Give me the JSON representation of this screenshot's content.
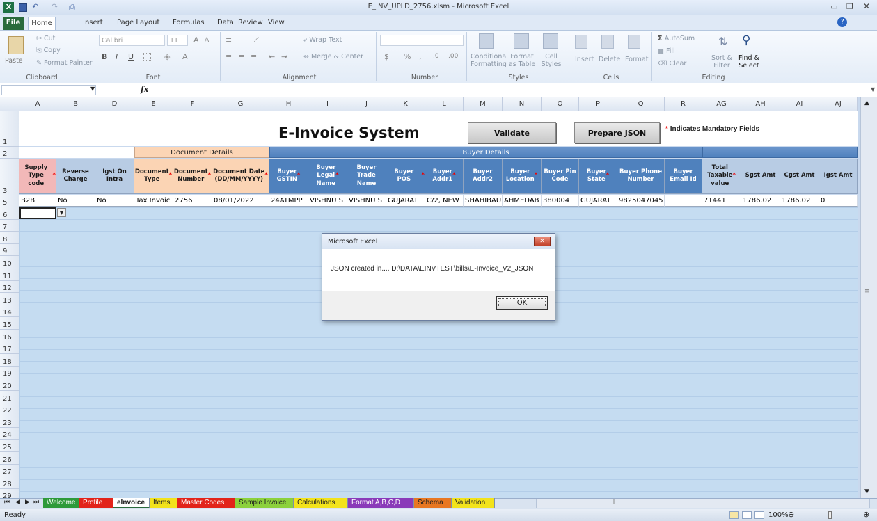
{
  "window": {
    "title": "E_INV_UPLD_2756.xlsm - Microsoft Excel"
  },
  "ribbon": {
    "tabs": [
      "File",
      "Home",
      "Insert",
      "Page Layout",
      "Formulas",
      "Data",
      "Review",
      "View"
    ],
    "clipboard": {
      "paste": "Paste",
      "cut": "Cut",
      "copy": "Copy",
      "format_painter": "Format Painter",
      "label": "Clipboard"
    },
    "font": {
      "name": "Calibri",
      "size": "11",
      "label": "Font"
    },
    "alignment": {
      "wrap_text": "Wrap Text",
      "merge_center": "Merge & Center",
      "label": "Alignment"
    },
    "number": {
      "label": "Number"
    },
    "styles": {
      "conditional": "Conditional Formatting",
      "format_table": "Format as Table",
      "cell_styles": "Cell Styles",
      "label": "Styles"
    },
    "cells": {
      "insert": "Insert",
      "delete": "Delete",
      "format": "Format",
      "label": "Cells"
    },
    "editing": {
      "autosum": "AutoSum",
      "fill": "Fill",
      "clear": "Clear",
      "sort_filter": "Sort & Filter",
      "find_select": "Find & Select",
      "label": "Editing"
    }
  },
  "columns": [
    "A",
    "B",
    "D",
    "E",
    "F",
    "G",
    "H",
    "I",
    "J",
    "K",
    "L",
    "M",
    "N",
    "O",
    "P",
    "Q",
    "R",
    "AG",
    "AH",
    "AI",
    "AJ"
  ],
  "rows": [
    "1",
    "2",
    "3",
    "5",
    "6",
    "7",
    "8",
    "9",
    "10",
    "11",
    "12",
    "13",
    "14",
    "15",
    "16",
    "17",
    "18",
    "19",
    "20",
    "21",
    "22",
    "23",
    "24",
    "25",
    "26",
    "27",
    "28",
    "29"
  ],
  "sheet": {
    "title": "E-Invoice System",
    "validate_button": "Validate",
    "prepare_json_button": "Prepare JSON",
    "mandatory_note": "Indicates Mandatory Fields",
    "mandatory_star": "*",
    "group_document": "Document Details",
    "group_buyer": "Buyer Details",
    "headers": [
      {
        "label": "Supply\nType code",
        "req": true
      },
      {
        "label": "Reverse\nCharge",
        "req": false
      },
      {
        "label": "Igst On\nIntra",
        "req": false
      },
      {
        "label": "Document\nType",
        "req": true
      },
      {
        "label": "Document\nNumber",
        "req": true
      },
      {
        "label": "Document Date\n(DD/MM/YYYY)",
        "req": true
      },
      {
        "label": "Buyer\nGSTIN",
        "req": true
      },
      {
        "label": "Buyer\nLegal\nName",
        "req": true
      },
      {
        "label": "Buyer\nTrade\nName",
        "req": false
      },
      {
        "label": "Buyer POS",
        "req": true
      },
      {
        "label": "Buyer\nAddr1",
        "req": true
      },
      {
        "label": "Buyer\nAddr2",
        "req": false
      },
      {
        "label": "Buyer\nLocation",
        "req": true
      },
      {
        "label": "Buyer Pin\nCode",
        "req": false
      },
      {
        "label": "Buyer\nState",
        "req": true
      },
      {
        "label": "Buyer Phone\nNumber",
        "req": false
      },
      {
        "label": "Buyer\nEmail Id",
        "req": false
      },
      {
        "label": "Total\nTaxable\nvalue",
        "req": true
      },
      {
        "label": "Sgst Amt",
        "req": false
      },
      {
        "label": "Cgst Amt",
        "req": false
      },
      {
        "label": "Igst Amt",
        "req": false
      }
    ],
    "data_row": [
      "B2B",
      "No",
      "No",
      "Tax Invoic",
      "2756",
      "08/01/2022",
      "24ATMPP",
      "VISHNU S",
      "VISHNU S",
      "GUJARAT",
      "C/2, NEW",
      "SHAHIBAU",
      "AHMEDAB",
      "380004",
      "GUJARAT",
      "9825047045",
      "",
      "71441",
      "1786.02",
      "1786.02",
      "0"
    ]
  },
  "dialog": {
    "title": "Microsoft Excel",
    "message": "JSON created in.... D:\\DATA\\EINVTEST\\bills\\E-Invoice_V2_JSON",
    "ok": "OK"
  },
  "sheet_tabs": [
    {
      "label": "Welcome",
      "color": "#2e9a3a"
    },
    {
      "label": "Profile",
      "color": "#e2231a"
    },
    {
      "label": "eInvoice",
      "color": "#ffffff"
    },
    {
      "label": "Items",
      "color": "#f3e31b"
    },
    {
      "label": "Master Codes",
      "color": "#e2231a"
    },
    {
      "label": "Sample Invoice",
      "color": "#8cd13c"
    },
    {
      "label": "Calculations",
      "color": "#f3e31b"
    },
    {
      "label": "Format A,B,C,D",
      "color": "#8a3ab9"
    },
    {
      "label": "Schema",
      "color": "#e87722"
    },
    {
      "label": "Validation",
      "color": "#f3e31b"
    }
  ],
  "status": {
    "ready": "Ready",
    "zoom": "100%"
  },
  "colors": {
    "title_bg": "#ffffff",
    "doc_header": "#f8c8a8",
    "buyer_header": "#4f81bd",
    "grid_fill": "#c5dcf1"
  }
}
